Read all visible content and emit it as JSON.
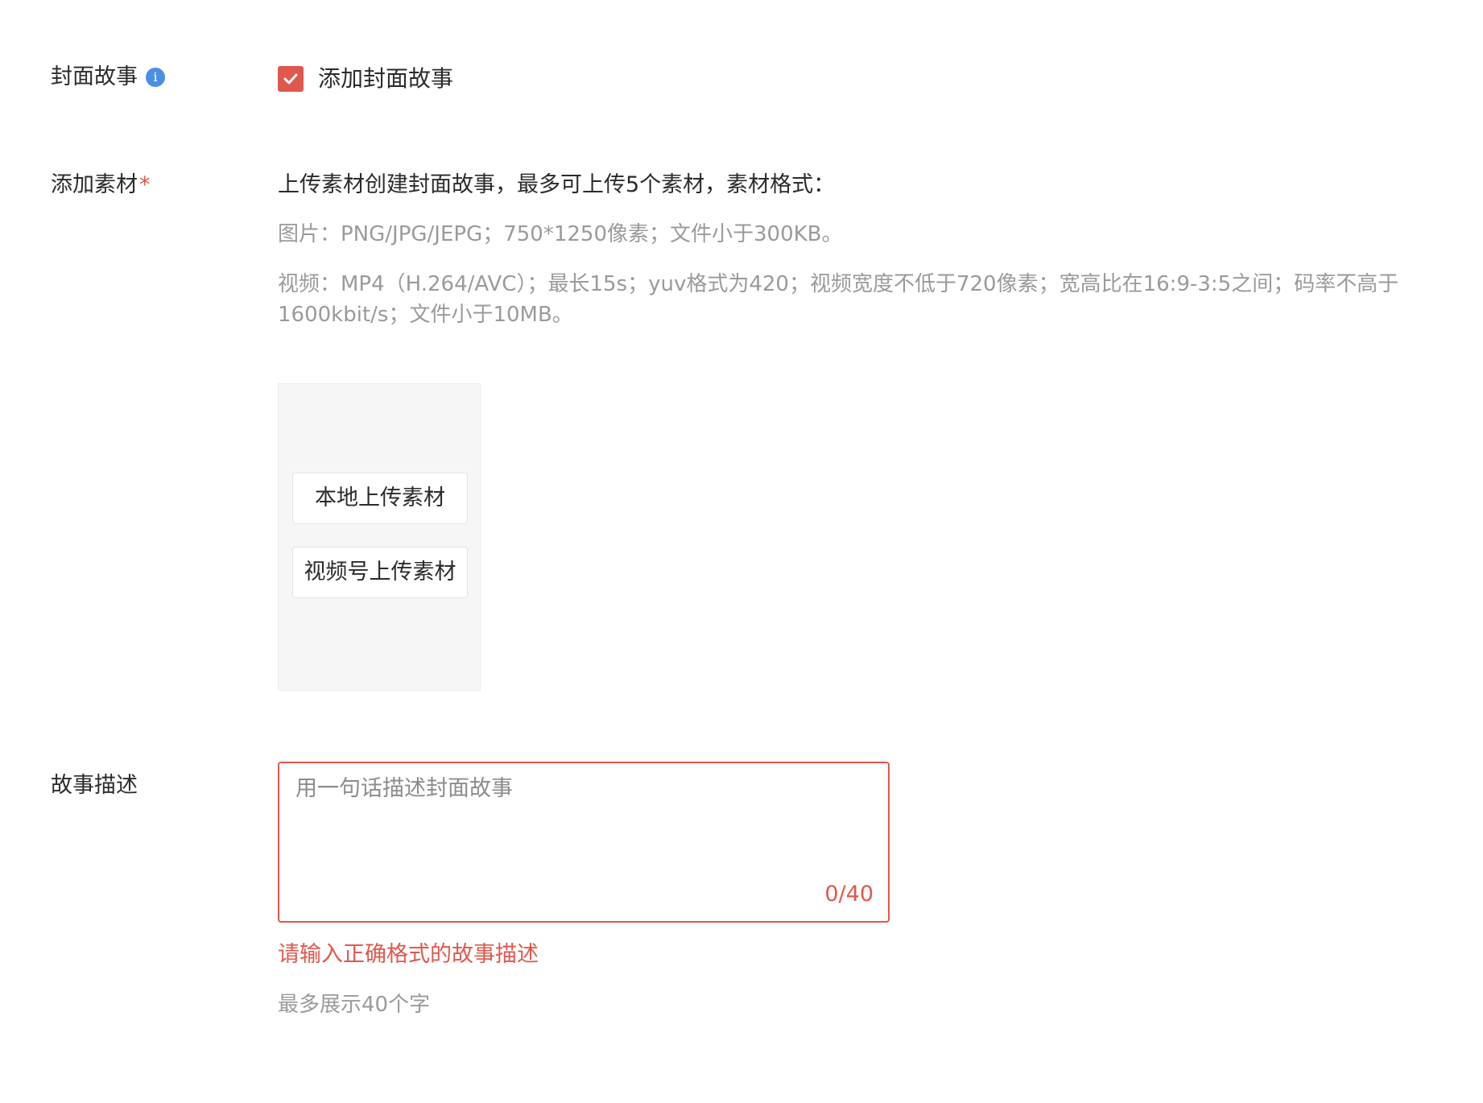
{
  "cover_story": {
    "label": "封面故事",
    "info_icon": "info-icon",
    "info_glyph": "i",
    "checkbox_label": "添加封面故事",
    "checked": true
  },
  "add_material": {
    "label": "添加素材",
    "required_mark": "*",
    "description": "上传素材创建封面故事，最多可上传5个素材，素材格式：",
    "image_spec": "图片：PNG/JPG/JEPG；750*1250像素；文件小于300KB。",
    "video_spec": "视频：MP4（H.264/AVC）；最长15s；yuv格式为420；视频宽度不低于720像素；宽高比在16:9-3:5之间；码率不高于1600kbit/s；文件小于10MB。",
    "upload_local_button": "本地上传素材",
    "upload_channel_button": "视频号上传素材"
  },
  "story_description": {
    "label": "故事描述",
    "placeholder": "用一句话描述封面故事",
    "value": "",
    "counter": "0/40",
    "error_message": "请输入正确格式的故事描述",
    "hint": "最多展示40个字"
  },
  "colors": {
    "accent_red": "#e0584d",
    "info_blue": "#4a90e2",
    "text_primary": "#2b2b2b",
    "text_secondary": "#9a9a9a"
  }
}
